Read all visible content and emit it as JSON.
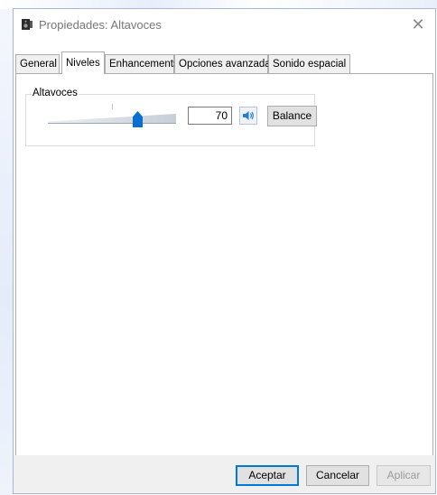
{
  "window": {
    "title": "Propiedades: Altavoces",
    "close_glyph": "✕"
  },
  "tabs": [
    {
      "label": "General",
      "active": false
    },
    {
      "label": "Niveles",
      "active": true
    },
    {
      "label": "Enhancements",
      "active": false
    },
    {
      "label": "Opciones avanzadas",
      "active": false
    },
    {
      "label": "Sonido espacial",
      "active": false
    }
  ],
  "levels": {
    "group_label": "Altavoces",
    "volume_value": "70",
    "volume_fraction": 0.7,
    "speaker_icon": "speaker-volume-icon",
    "balance_label": "Balance"
  },
  "footer": {
    "accept_label": "Aceptar",
    "cancel_label": "Cancelar",
    "apply_label": "Aplicar",
    "apply_enabled": false
  },
  "colors": {
    "accent": "#0a6ed1",
    "primary_border": "#0078d7"
  }
}
